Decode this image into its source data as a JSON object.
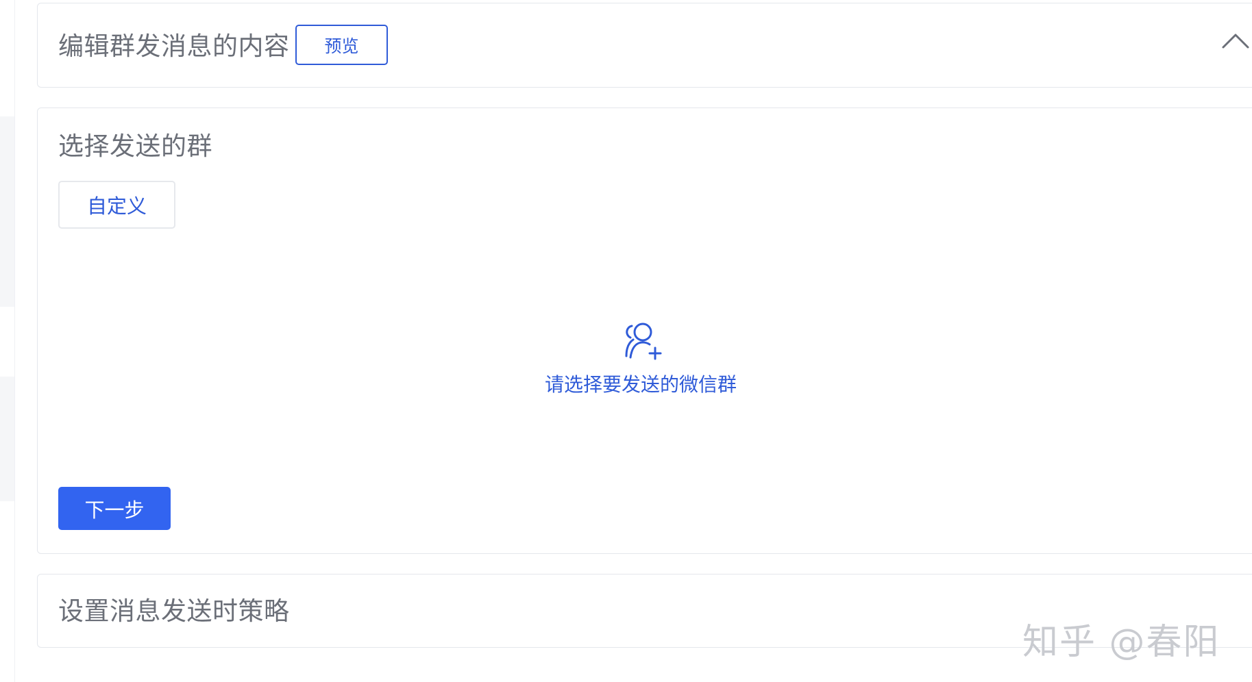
{
  "sections": {
    "edit_content": {
      "title": "编辑群发消息的内容",
      "preview_label": "预览",
      "collapse_icon": "chevron-up-icon"
    },
    "select_group": {
      "title": "选择发送的群",
      "custom_label": "自定义",
      "empty_icon": "add-users-icon",
      "empty_text": "请选择要发送的微信群",
      "next_label": "下一步"
    },
    "send_strategy": {
      "title": "设置消息发送时策略"
    }
  },
  "watermark": "知乎 @春阳",
  "colors": {
    "accent": "#2f5bd8",
    "primary_button": "#3264f0",
    "title_text": "#6b6f78",
    "border": "#e4e7ec"
  }
}
